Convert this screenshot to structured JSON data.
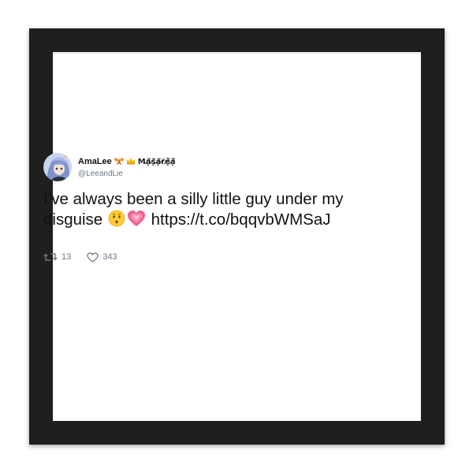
{
  "tweet": {
    "display_name": "AmaLee",
    "badges": [
      "butterfly-icon",
      "crown-icon"
    ],
    "name_suffix": "Mặ̸ṩ̸ặ̸r̸ệ̸ậ̸",
    "handle": "@LeeandLie",
    "text_part1": "I’ve always been a silly little guy under my disguise",
    "emojis": [
      "kissing-face-icon",
      "growing-heart-icon"
    ],
    "link": "https://t.co/bqqvbWMSaJ",
    "retweets": "13",
    "likes": "343"
  },
  "colors": {
    "frame": "#1f1f1f",
    "text": "#111111",
    "muted": "#6b7a86",
    "heart": "#e84a8a",
    "badge_gold": "#f5b800"
  }
}
